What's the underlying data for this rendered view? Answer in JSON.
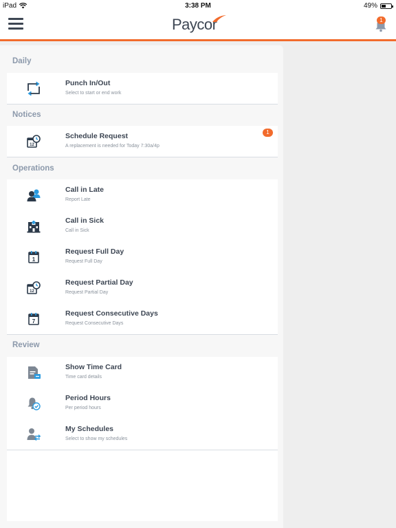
{
  "status_bar": {
    "device": "iPad",
    "time": "3:38 PM",
    "battery": "49%",
    "battery_level": 0.49
  },
  "header": {
    "logo_text": "Paycor",
    "notification_count": "1",
    "brand_color": "#f26b2c"
  },
  "sections": {
    "daily": {
      "label": "Daily",
      "items": [
        {
          "title": "Punch In/Out",
          "subtitle": "Select to start or end work",
          "icon": "punch-clock-icon"
        }
      ]
    },
    "notices": {
      "label": "Notices",
      "items": [
        {
          "title": "Schedule Request",
          "subtitle": "A replacement is needed for Today 7:30a/4p",
          "badge": "1",
          "icon": "calendar-clock-icon"
        }
      ]
    },
    "operations": {
      "label": "Operations",
      "items": [
        {
          "title": "Call in Late",
          "subtitle": "Report Late",
          "icon": "people-icon"
        },
        {
          "title": "Call in Sick",
          "subtitle": "Call in Sick",
          "icon": "hospital-icon"
        },
        {
          "title": "Request Full Day",
          "subtitle": "Request Full Day",
          "icon": "calendar-one-icon"
        },
        {
          "title": "Request Partial Day",
          "subtitle": "Request Partial Day",
          "icon": "calendar-clock-icon"
        },
        {
          "title": "Request Consecutive Days",
          "subtitle": "Request Consecutive Days",
          "icon": "calendar-seven-icon"
        }
      ]
    },
    "review": {
      "label": "Review",
      "items": [
        {
          "title": "Show Time Card",
          "subtitle": "Time card details",
          "icon": "time-card-icon"
        },
        {
          "title": "Period Hours",
          "subtitle": "Per period hours",
          "icon": "bell-check-icon"
        },
        {
          "title": "My Schedules",
          "subtitle": "Select to show my schedules",
          "icon": "user-schedule-icon"
        }
      ]
    }
  },
  "icon_labels": {
    "calendar_one": "1",
    "calendar_seven": "7",
    "calendar_twelve": "12"
  }
}
